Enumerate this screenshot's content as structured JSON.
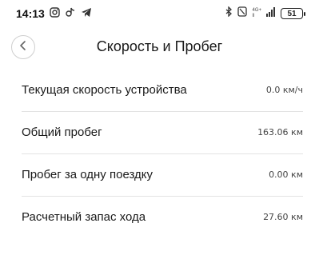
{
  "status_bar": {
    "time": "14:13",
    "network_top": "4G+",
    "network_bottom": "ll",
    "battery": "51"
  },
  "header": {
    "title": "Скорость и Пробег"
  },
  "rows": [
    {
      "label": "Текущая скорость устройства",
      "value": "0.0 км/ч"
    },
    {
      "label": "Общий пробег",
      "value": "163.06 км"
    },
    {
      "label": "Пробег за одну поездку",
      "value": "0.00 км"
    },
    {
      "label": "Расчетный запас хода",
      "value": "27.60 км"
    }
  ],
  "icons": {
    "instagram": "instagram-icon",
    "tiktok": "tiktok-icon",
    "telegram": "telegram-icon",
    "bluetooth": "bluetooth-icon",
    "mute": "mute-icon",
    "back": "chevron-left-icon"
  }
}
